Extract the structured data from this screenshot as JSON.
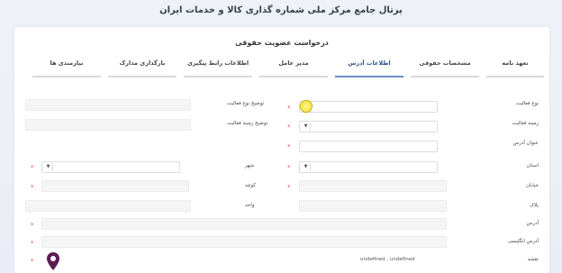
{
  "header": {
    "title": "پرتال جامع مرکز ملی شماره گذاری کالا و خدمات ایران"
  },
  "card": {
    "title": "درخواست عضویت حقوقی"
  },
  "tabs": [
    {
      "label": "تعهد نامه",
      "active": false
    },
    {
      "label": "مشخصات حقوقی",
      "active": false
    },
    {
      "label": "اطلاعات آدرس",
      "active": true
    },
    {
      "label": "مدیر عامل",
      "active": false
    },
    {
      "label": "اطلاعات رابط پیگیری",
      "active": false
    },
    {
      "label": "بارگذاری مدارک",
      "active": false
    },
    {
      "label": "نیازمندی ها",
      "active": false
    }
  ],
  "right_labels": {
    "activity_type": "نوع فعالیت",
    "activity_field": "زمینه فعالیت",
    "address_title": "عنوان آدرس",
    "province": "استان",
    "street": "خیابان",
    "plaque": "پلاک",
    "address": "آدرس",
    "address_en": "آدرس انگلیسی",
    "map": "نقشه"
  },
  "middle_labels": {
    "activity_type_desc": "توضیح نوع فعالیت",
    "activity_field_desc": "توضیح زمینه فعالیت",
    "city": "شهر",
    "alley": "کوچه",
    "unit": "واحد"
  },
  "map_coords": "undefined , undefined",
  "icons": {
    "pin": "map-pin-icon",
    "dropdown": "chevron-down-icon"
  },
  "colors": {
    "accent": "#6b8fc9",
    "required": "#e34a5a",
    "pin": "#5a1d52"
  }
}
